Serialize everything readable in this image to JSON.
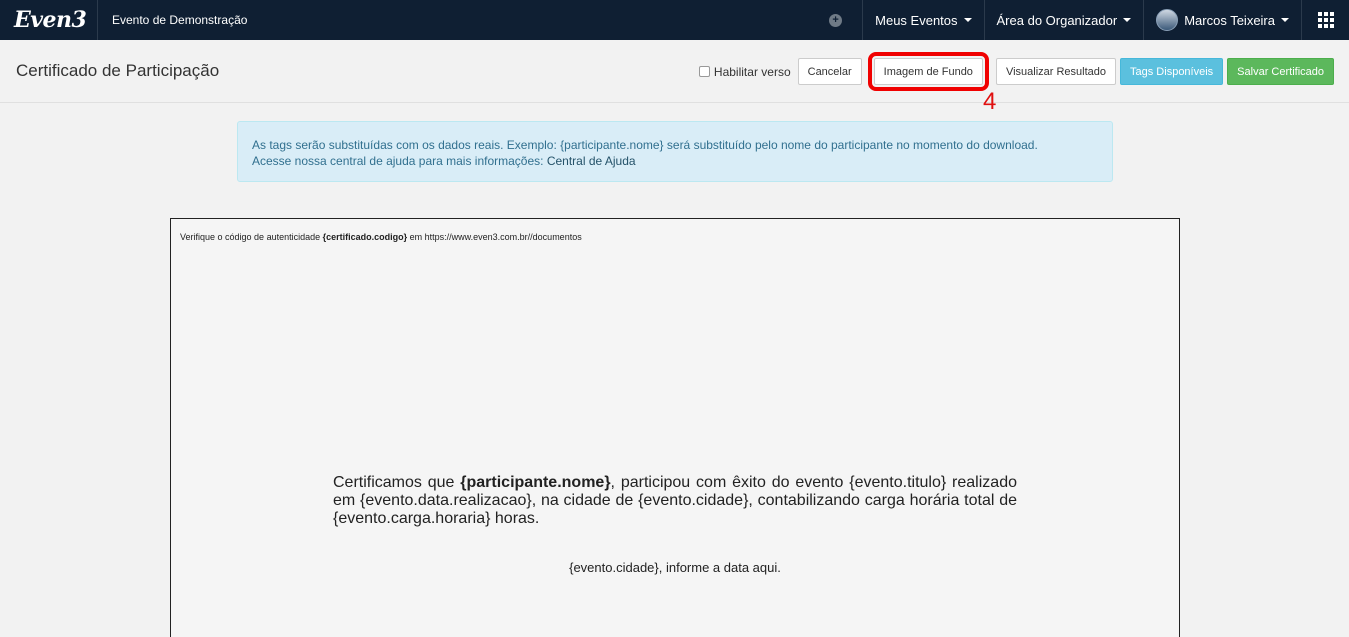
{
  "navbar": {
    "logo": "Even3",
    "event_name": "Evento de Demonstração",
    "my_events": "Meus Eventos",
    "organizer_area": "Área do Organizador",
    "user_name": "Marcos Teixeira"
  },
  "header": {
    "title": "Certificado de Participação",
    "enable_back_label": "Habilitar verso",
    "cancel_label": "Cancelar",
    "background_image_label": "Imagem de Fundo",
    "preview_label": "Visualizar Resultado",
    "tags_label": "Tags Disponíveis",
    "save_label": "Salvar Certificado"
  },
  "annotation": {
    "number": "4",
    "color": "#f00000"
  },
  "alert": {
    "line1": "As tags serão substituídas com os dados reais. Exemplo: {participante.nome} será substituído pelo nome do participante no momento do download.",
    "line2_prefix": "Acesse nossa central de ajuda para mais informações: ",
    "help_link": "Central de Ajuda"
  },
  "certificate": {
    "verify_prefix": "Verifique o código de autenticidade ",
    "verify_code_tag": "{certificado.codigo}",
    "verify_suffix": " em https://www.even3.com.br//documentos",
    "body_prefix": "Certificamos que ",
    "participant_tag": "{participante.nome}",
    "body_rest": ", participou com êxito do evento {evento.titulo} realizado em {evento.data.realizacao}, na cidade de {evento.cidade}, contabilizando carga horária total de {evento.carga.horaria} horas.",
    "date_line": "{evento.cidade}, informe a data aqui."
  },
  "colors": {
    "navbar_bg": "#0f1f33",
    "info_button": "#5bc0de",
    "success_button": "#5cb85c",
    "alert_bg": "#d9edf7"
  }
}
